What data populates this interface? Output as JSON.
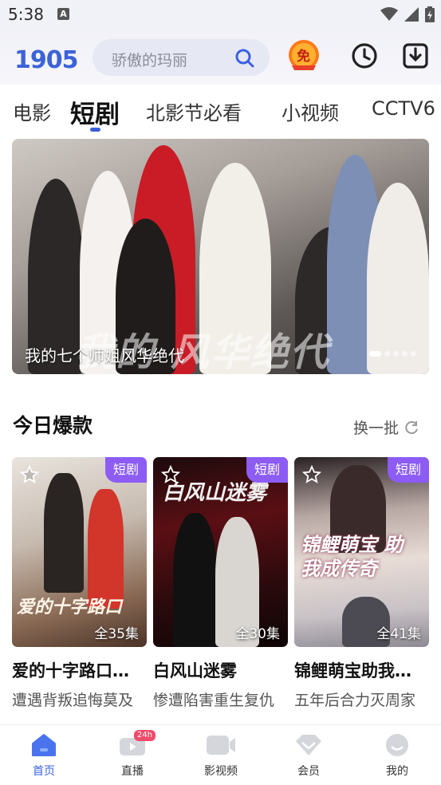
{
  "status_bar": {
    "time": "5:38",
    "notification_icon": "A"
  },
  "header": {
    "logo": "1905",
    "search_placeholder": "骄傲的玛丽",
    "free_badge": "免"
  },
  "tabs": [
    {
      "label": "电影",
      "active": false
    },
    {
      "label": "短剧",
      "active": true
    },
    {
      "label": "北影节必看",
      "active": false
    },
    {
      "label": "小视频",
      "active": false
    },
    {
      "label": "CCTV6",
      "active": false
    }
  ],
  "banner": {
    "title": "我的七个师姐风华绝代",
    "art_text": "我的 风华绝代",
    "page_count": 5,
    "active_page": 1
  },
  "section": {
    "title": "今日爆款",
    "refresh_label": "换一批"
  },
  "cards": [
    {
      "badge": "短剧",
      "episodes": "全35集",
      "title": "爱的十字路口…",
      "subtitle": "遭遇背叛追悔莫及",
      "art_text": "爱的十字路口"
    },
    {
      "badge": "短剧",
      "episodes": "全30集",
      "title": "白风山迷雾",
      "subtitle": "惨遭陷害重生复仇",
      "art_text": "白风山迷雾"
    },
    {
      "badge": "短剧",
      "episodes": "全41集",
      "title": "锦鲤萌宝助我…",
      "subtitle": "五年后合力灭周家",
      "art_text": "锦鲤萌宝 助我成传奇"
    }
  ],
  "bottom_nav": [
    {
      "label": "首页",
      "icon": "home-icon",
      "active": true
    },
    {
      "label": "直播",
      "icon": "live-icon",
      "badge": "24h",
      "active": false
    },
    {
      "label": "影视频",
      "icon": "video-icon",
      "active": false
    },
    {
      "label": "会员",
      "icon": "vip-diamond-icon",
      "active": false
    },
    {
      "label": "我的",
      "icon": "profile-icon",
      "active": false
    }
  ],
  "colors": {
    "accent": "#3a62e0",
    "badge": "#8c5cf4"
  }
}
